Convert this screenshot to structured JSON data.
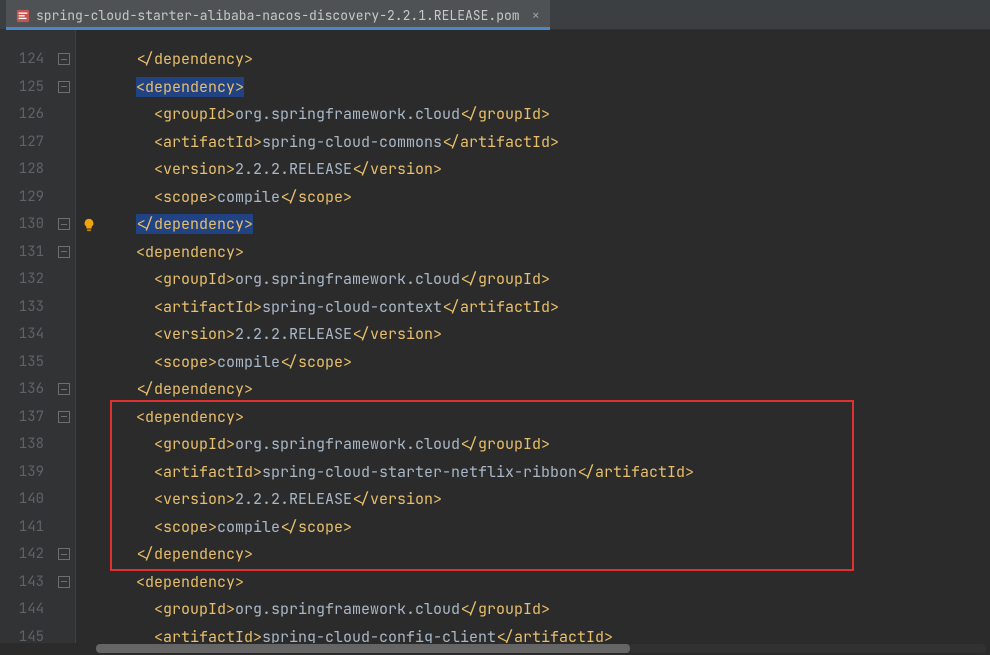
{
  "tab": {
    "filename": "spring-cloud-starter-alibaba-nacos-discovery-2.2.1.RELEASE.pom",
    "close_glyph": "×"
  },
  "editor": {
    "first_line_number": 124,
    "intention_line": 130
  },
  "highlighted_lines": [
    125,
    130
  ],
  "red_box": {
    "from_line": 137,
    "to_line": 142
  },
  "dependencies": [
    {
      "groupId": "org.springframework.cloud",
      "artifactId": "spring-cloud-commons",
      "version": "2.2.2.RELEASE",
      "scope": "compile"
    },
    {
      "groupId": "org.springframework.cloud",
      "artifactId": "spring-cloud-context",
      "version": "2.2.2.RELEASE",
      "scope": "compile"
    },
    {
      "groupId": "org.springframework.cloud",
      "artifactId": "spring-cloud-starter-netflix-ribbon",
      "version": "2.2.2.RELEASE",
      "scope": "compile"
    },
    {
      "groupId": "org.springframework.cloud",
      "artifactId": "spring-cloud-config-client"
    }
  ],
  "tag_names": {
    "dependency": "dependency",
    "groupId": "groupId",
    "artifactId": "artifactId",
    "version": "version",
    "scope": "scope"
  }
}
